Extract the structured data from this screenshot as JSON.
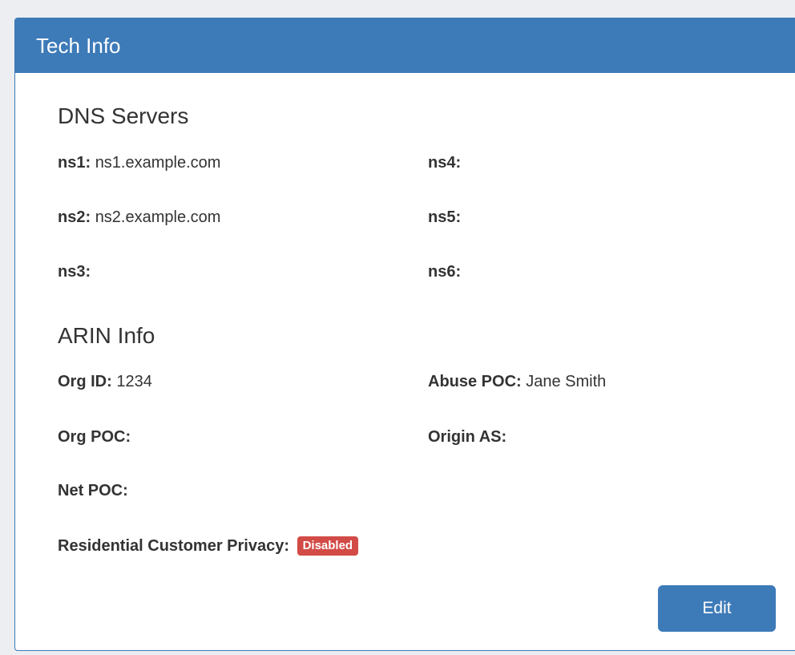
{
  "panel": {
    "title": "Tech Info"
  },
  "dns": {
    "heading": "DNS Servers",
    "servers": [
      {
        "label": "ns1:",
        "value": "ns1.example.com"
      },
      {
        "label": "ns2:",
        "value": "ns2.example.com"
      },
      {
        "label": "ns3:",
        "value": ""
      },
      {
        "label": "ns4:",
        "value": ""
      },
      {
        "label": "ns5:",
        "value": ""
      },
      {
        "label": "ns6:",
        "value": ""
      }
    ]
  },
  "arin": {
    "heading": "ARIN Info",
    "org_id_label": "Org ID:",
    "org_id_value": "1234",
    "abuse_poc_label": "Abuse POC:",
    "abuse_poc_value": "Jane Smith",
    "org_poc_label": "Org POC:",
    "org_poc_value": "",
    "origin_as_label": "Origin AS:",
    "origin_as_value": "",
    "net_poc_label": "Net POC:",
    "net_poc_value": "",
    "privacy_label": "Residential Customer Privacy:",
    "privacy_status": "Disabled"
  },
  "actions": {
    "edit_label": "Edit"
  },
  "colors": {
    "header": "#3d7ab8",
    "badge_disabled": "#d24b46"
  }
}
